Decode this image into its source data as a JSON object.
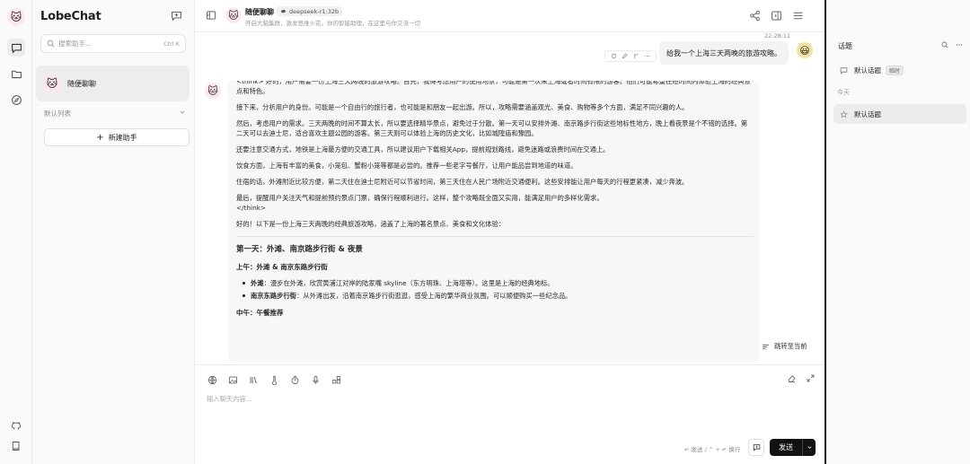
{
  "app": {
    "name": "LobeChat"
  },
  "sidebar": {
    "search_placeholder": "搜索助手...",
    "search_shortcut": "Ctrl K",
    "chat_item": "随便聊聊",
    "group_label": "默认列表",
    "new_agent": "新建助手"
  },
  "header": {
    "title": "随便聊聊",
    "model": "deepseek-r1:32b",
    "description": "开启大脑集群，激发思维火花。你的智能助理，在这里与你交流一切"
  },
  "conversation": {
    "timestamp": "22:28:11",
    "user_message": "给我一个上海三天两晚的旅游攻略。",
    "bot": {
      "think_paragraphs": [
        "<think> 好的，用户需要一份上海三天两晚的旅游攻略。首先，我得考虑用户的使用场景，可能是第一次来上海或者时间有限的游客。他们可能希望在短时间内体验上海的经典景点和特色。",
        "接下来，分析用户的身份。可能是一个自由行的旅行者，也可能是和朋友一起出游。所以，攻略需要涵盖观光、美食、购物等多个方面，满足不同兴趣的人。",
        "然后，考虑用户的需求。三天两晚的时间不算太长，所以要选择精华景点，避免过于分散。第一天可以安排外滩、南京路步行街这些地标性地方，晚上看夜景是个不错的选择。第二天可以去迪士尼，适合喜欢主题公园的游客。第三天则可以体验上海的历史文化，比如城隍庙和豫园。",
        "还要注意交通方式，地铁是上海最方便的交通工具，所以建议用户下载相关App，提前规划路线，避免迷路或浪费时间在交通上。",
        "饮食方面，上海有丰富的美食，小笼包、蟹粉小笼等都是必尝的。推荐一些老字号餐厅，让用户能品尝到地道的味道。",
        "住宿的话，外滩附近比较方便，第二天住在迪士尼附近可以节省时间，第三天住在人民广场附近交通便利。这些安排能让用户每天的行程更紧凑，减少奔波。",
        "最后，提醒用户关注天气和提前预约景点门票，确保行程顺利进行。这样，整个攻略既全面又实用，能满足用户的多样化需求。"
      ],
      "think_end": "</think>",
      "intro": "好的！以下是一份上海三天两晚的经典旅游攻略，涵盖了上海的著名景点、美食和文化体验：",
      "day1_title": "第一天：外滩、南京路步行街 & 夜景",
      "morning_title": "上午：外滩 & 南京东路步行街",
      "bullets": [
        {
          "bold": "外滩",
          "text": "：漫步在外滩，欣赏黄浦江对岸的陆家嘴 skyline（东方明珠、上海塔等）。这里是上海的经典地标。"
        },
        {
          "bold": "南京东路步行街",
          "text": "：从外滩出发，沿着南京路步行街逛逛，感受上海的繁华商业氛围。可以顺便购买一些纪念品。"
        }
      ],
      "noon_title": "中午：午餐推荐"
    },
    "jump_label": "跳转至当前"
  },
  "composer": {
    "placeholder": "输入聊天内容...",
    "hint": "↵ 发送 / ⌃ + ↵ 换行",
    "send_label": "发送"
  },
  "topics": {
    "title": "话题",
    "default_topic": "默认话题",
    "temp_badge": "临时",
    "today_label": "今天",
    "today_topic": "默认话题"
  },
  "colors": {
    "accent": "#111111",
    "panel_bg": "#fafafa",
    "bubble_bg": "#f3f3f3"
  }
}
